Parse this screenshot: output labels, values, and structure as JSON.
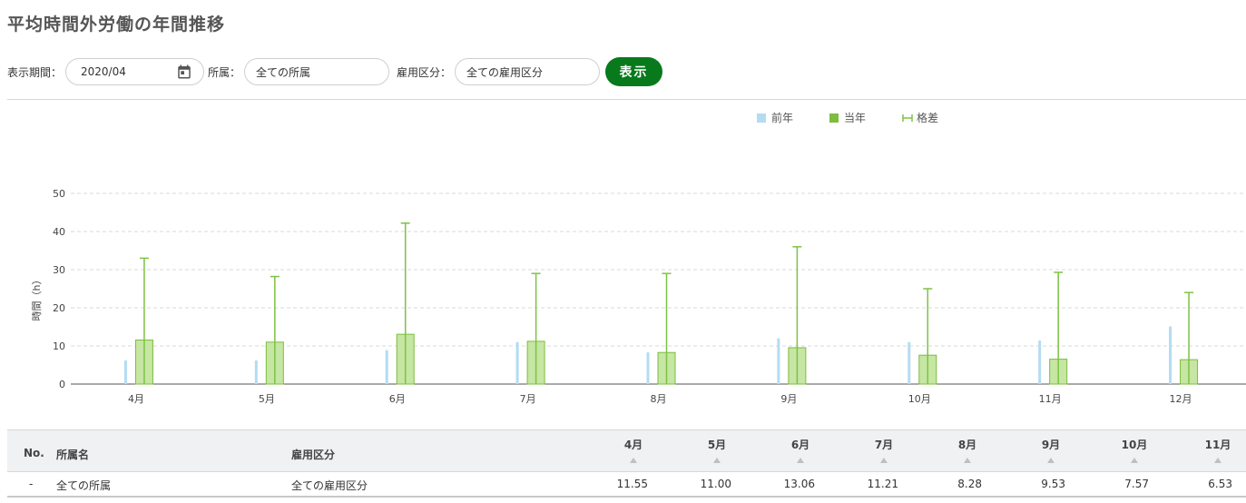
{
  "page": {
    "title": "平均時間外労働の年間推移"
  },
  "filters": {
    "period_label": "表示期間：",
    "period_value": "2020/04",
    "dept_label": "所属：",
    "dept_value": "全ての所属",
    "emp_label": "雇用区分：",
    "emp_value": "全ての雇用区分",
    "show_button": "表示"
  },
  "colors": {
    "prev": "#b3dcf3",
    "curr": "#c6e6a4",
    "curr_stroke": "#7dbd3d",
    "diff": "#7dc243",
    "button": "#087a1c"
  },
  "chart_data": {
    "type": "bar",
    "categories": [
      "4月",
      "5月",
      "6月",
      "7月",
      "8月",
      "9月",
      "10月",
      "11月",
      "12月"
    ],
    "series": [
      {
        "name": "前年",
        "values": [
          6.2,
          6.2,
          8.9,
          11.0,
          8.3,
          12.0,
          11.0,
          11.4,
          15.1
        ]
      },
      {
        "name": "当年",
        "values": [
          11.55,
          11.0,
          13.06,
          11.21,
          8.28,
          9.53,
          7.57,
          6.53,
          6.4
        ]
      },
      {
        "name": "格差",
        "type": "errorbar",
        "values": [
          33,
          28.2,
          42.2,
          29,
          29,
          36,
          25,
          29.3,
          24
        ]
      }
    ],
    "ylabel": "時間（h）",
    "yticks": [
      0,
      10,
      20,
      30,
      40,
      50
    ],
    "ylim": [
      0,
      50
    ],
    "grid": true,
    "legend": "top-right"
  },
  "table": {
    "headers": {
      "no": "No.",
      "dept": "所属名",
      "emp": "雇用区分"
    },
    "months": [
      "4月",
      "5月",
      "6月",
      "7月",
      "8月",
      "9月",
      "10月",
      "11月"
    ],
    "rows": [
      {
        "no": "-",
        "dept": "全ての所属",
        "emp": "全ての雇用区分",
        "values": [
          "11.55",
          "11.00",
          "13.06",
          "11.21",
          "8.28",
          "9.53",
          "7.57",
          "6.53"
        ]
      }
    ]
  }
}
